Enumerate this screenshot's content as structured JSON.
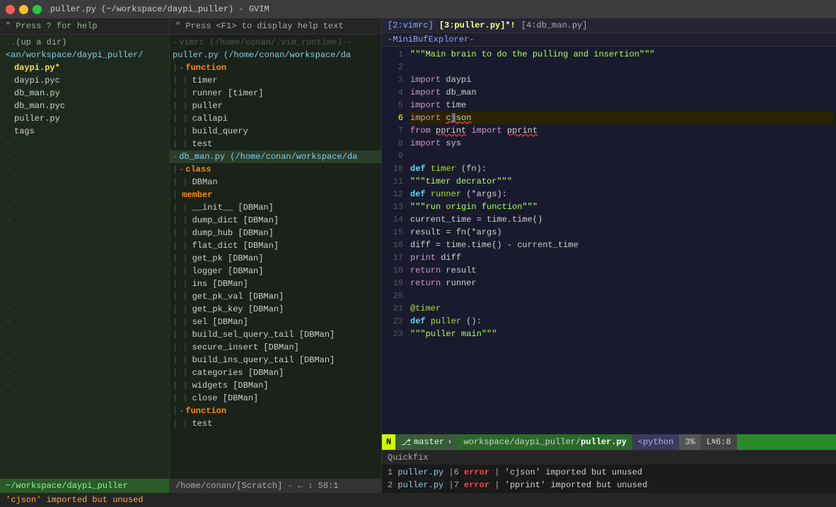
{
  "titlebar": {
    "title": "puller.py (~/workspace/daypi_puller) - GVIM"
  },
  "sidebar": {
    "header": "\" Press ? for help",
    "items": [
      {
        "indent": "",
        "type": "dotdot",
        "text": ".. (up a dir)"
      },
      {
        "indent": "",
        "type": "dir",
        "text": "<an/workspace/daypi_puller/"
      },
      {
        "indent": "  ",
        "type": "file-active",
        "text": "daypi.py*"
      },
      {
        "indent": "  ",
        "type": "file",
        "text": "daypi.pyc"
      },
      {
        "indent": "  ",
        "type": "file",
        "text": "db_man.py"
      },
      {
        "indent": "  ",
        "type": "file",
        "text": "db_man.pyc"
      },
      {
        "indent": "  ",
        "type": "file",
        "text": "puller.py"
      },
      {
        "indent": "  ",
        "type": "file",
        "text": "tags"
      }
    ],
    "footer": "~/workspace/daypi_puller"
  },
  "middle": {
    "header": "\" Press <F1> to display help text",
    "filename": "puller.py (/home/conan/workspace/da",
    "items": [
      {
        "indent": "|-",
        "type": "keyword",
        "text": "function"
      },
      {
        "indent": "| |",
        "type": "name",
        "text": "timer"
      },
      {
        "indent": "| |",
        "type": "name",
        "text": "runner [timer]"
      },
      {
        "indent": "| |",
        "type": "name",
        "text": "puller"
      },
      {
        "indent": "| |",
        "type": "name",
        "text": "callapi"
      },
      {
        "indent": "| |",
        "type": "name",
        "text": "build_query"
      },
      {
        "indent": "| |",
        "type": "name",
        "text": "test"
      },
      {
        "indent": "-",
        "type": "filename",
        "text": "db_man.py (/home/conan/workspace/da"
      },
      {
        "indent": "|-",
        "type": "keyword",
        "text": "class"
      },
      {
        "indent": "| |",
        "type": "name",
        "text": "DBMan"
      },
      {
        "indent": "|",
        "type": "keyword",
        "text": "member"
      },
      {
        "indent": "| |",
        "type": "name",
        "text": "__init__ [DBMan]"
      },
      {
        "indent": "| |",
        "type": "name",
        "text": "dump_dict [DBMan]"
      },
      {
        "indent": "| |",
        "type": "name",
        "text": "dump_hub [DBMan]"
      },
      {
        "indent": "| |",
        "type": "name",
        "text": "flat_dict [DBMan]"
      },
      {
        "indent": "| |",
        "type": "name",
        "text": "get_pk [DBMan]"
      },
      {
        "indent": "| |",
        "type": "name",
        "text": "logger [DBMan]"
      },
      {
        "indent": "| |",
        "type": "name",
        "text": "ins [DBMan]"
      },
      {
        "indent": "| |",
        "type": "name",
        "text": "get_pk_val [DBMan]"
      },
      {
        "indent": "| |",
        "type": "name",
        "text": "get_pk_key [DBMan]"
      },
      {
        "indent": "| |",
        "type": "name",
        "text": "sel [DBMan]"
      },
      {
        "indent": "| |",
        "type": "name",
        "text": "build_sel_query_tail [DBMan]"
      },
      {
        "indent": "| |",
        "type": "name",
        "text": "secure_insert [DBMan]"
      },
      {
        "indent": "| |",
        "type": "name",
        "text": "build_ins_query_tail [DBMan]"
      },
      {
        "indent": "| |",
        "type": "name",
        "text": "categories [DBMan]"
      },
      {
        "indent": "| |",
        "type": "name",
        "text": "widgets [DBMan]"
      },
      {
        "indent": "| |",
        "type": "name",
        "text": "close [DBMan]"
      },
      {
        "indent": "|-",
        "type": "keyword",
        "text": "function"
      },
      {
        "indent": "| |",
        "type": "name",
        "text": "test"
      }
    ],
    "footer": "/home/conan/[Scratch] -  ← ↕  58:1"
  },
  "code": {
    "tabbar": "[2:vimrc][3:puller.py]*![4:db_man.py]",
    "minibuf": "-MiniBufExplorer-",
    "lines": [
      {
        "num": 1,
        "content": "\"\"\"Main brain to do the pulling and insertion\"\"\""
      },
      {
        "num": 2,
        "content": ""
      },
      {
        "num": 3,
        "content": "import daypi"
      },
      {
        "num": 4,
        "content": "import db_man"
      },
      {
        "num": 5,
        "content": "import time"
      },
      {
        "num": 6,
        "content": "import cjson",
        "error": true
      },
      {
        "num": 7,
        "content": "from pprint import pprint",
        "error": true
      },
      {
        "num": 8,
        "content": "import sys"
      },
      {
        "num": 9,
        "content": ""
      },
      {
        "num": 10,
        "content": "def timer(fn):"
      },
      {
        "num": 11,
        "content": "    \"\"\"timer decrator\"\"\""
      },
      {
        "num": 12,
        "content": "    def runner(*args):"
      },
      {
        "num": 13,
        "content": "        \"\"\"run origin function\"\"\""
      },
      {
        "num": 14,
        "content": "        current_time = time.time()"
      },
      {
        "num": 15,
        "content": "        result = fn(*args)"
      },
      {
        "num": 16,
        "content": "        diff = time.time() - current_time"
      },
      {
        "num": 17,
        "content": "        print diff"
      },
      {
        "num": 18,
        "content": "        return result"
      },
      {
        "num": 19,
        "content": "    return runner"
      },
      {
        "num": 20,
        "content": ""
      },
      {
        "num": 21,
        "content": "@timer"
      },
      {
        "num": 22,
        "content": "def puller():"
      },
      {
        "num": 23,
        "content": "    \"\"\"puller main\"\"\""
      }
    ]
  },
  "statusbar": {
    "mode": "N",
    "branch_icon": "⎇",
    "branch": "master",
    "path_prefix": "workspace/daypi_puller/",
    "filename": "puller.py",
    "filetype": "<python",
    "percent": "3%",
    "linenum": "6:8"
  },
  "quickfix": {
    "label": "Quickfix",
    "errors": [
      {
        "num": 1,
        "file": "puller.py",
        "line": 6,
        "type": "error",
        "msg": "'cjson' imported but unused"
      },
      {
        "num": 2,
        "file": "puller.py",
        "line": 7,
        "type": "error",
        "msg": "'pprint' imported but unused"
      }
    ]
  },
  "bottom_status": {
    "text": "'cjson' imported but unused"
  }
}
